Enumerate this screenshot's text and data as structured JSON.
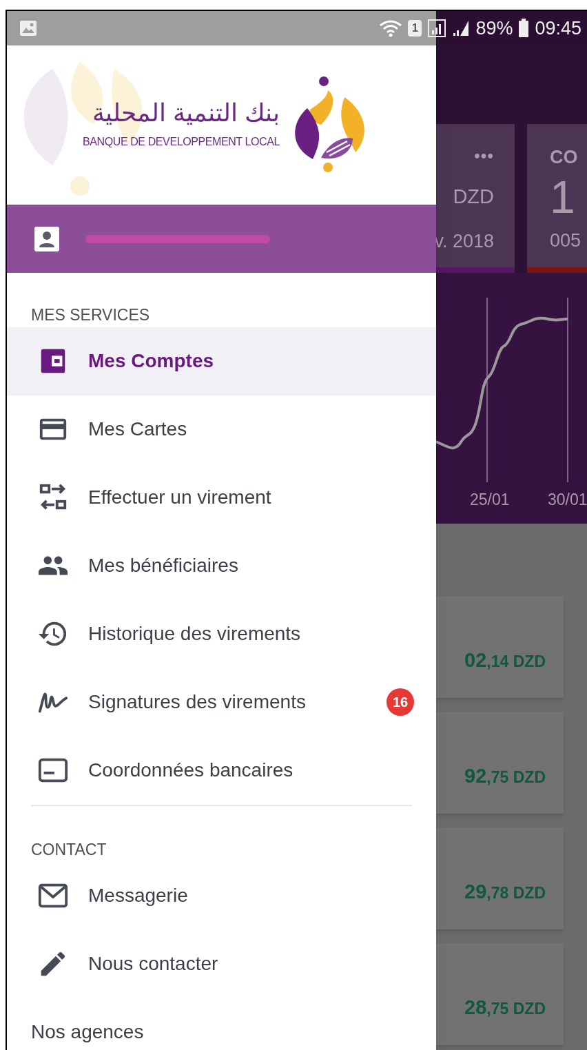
{
  "status_bar": {
    "sim": "1",
    "battery": "89%",
    "time": "09:45"
  },
  "drawer": {
    "logo": {
      "arabic": "بنك التنمية المحلية",
      "name": "BANQUE DE DEVELOPPEMENT LOCAL"
    },
    "sections": [
      {
        "title": "MES SERVICES",
        "items": [
          {
            "label": "Mes Comptes",
            "selected": true
          },
          {
            "label": "Mes Cartes",
            "selected": false
          },
          {
            "label": "Effectuer un virement",
            "selected": false
          },
          {
            "label": "Mes bénéficiaires",
            "selected": false
          },
          {
            "label": "Historique des virements",
            "selected": false
          },
          {
            "label": "Signatures des virements",
            "selected": false,
            "badge": "16"
          },
          {
            "label": "Coordonnées bancaires",
            "selected": false
          }
        ]
      },
      {
        "title": "CONTACT",
        "items": [
          {
            "label": "Messagerie",
            "selected": false
          },
          {
            "label": "Nous contacter",
            "selected": false
          },
          {
            "label": "Nos agences",
            "selected": false
          }
        ]
      }
    ]
  },
  "background": {
    "card_left": {
      "menu": "•••",
      "currency": "DZD",
      "date": "v. 2018"
    },
    "card_right": {
      "title": "CO",
      "value": "1",
      "account": "005"
    },
    "chart": {
      "dates": [
        "25/01",
        "30/01"
      ]
    },
    "amounts": [
      {
        "main": "02",
        "cents": ",14 DZD"
      },
      {
        "main": "92",
        "cents": ",75 DZD"
      },
      {
        "main": "29",
        "cents": ",78 DZD"
      },
      {
        "main": "28",
        "cents": ",75 DZD"
      }
    ]
  }
}
